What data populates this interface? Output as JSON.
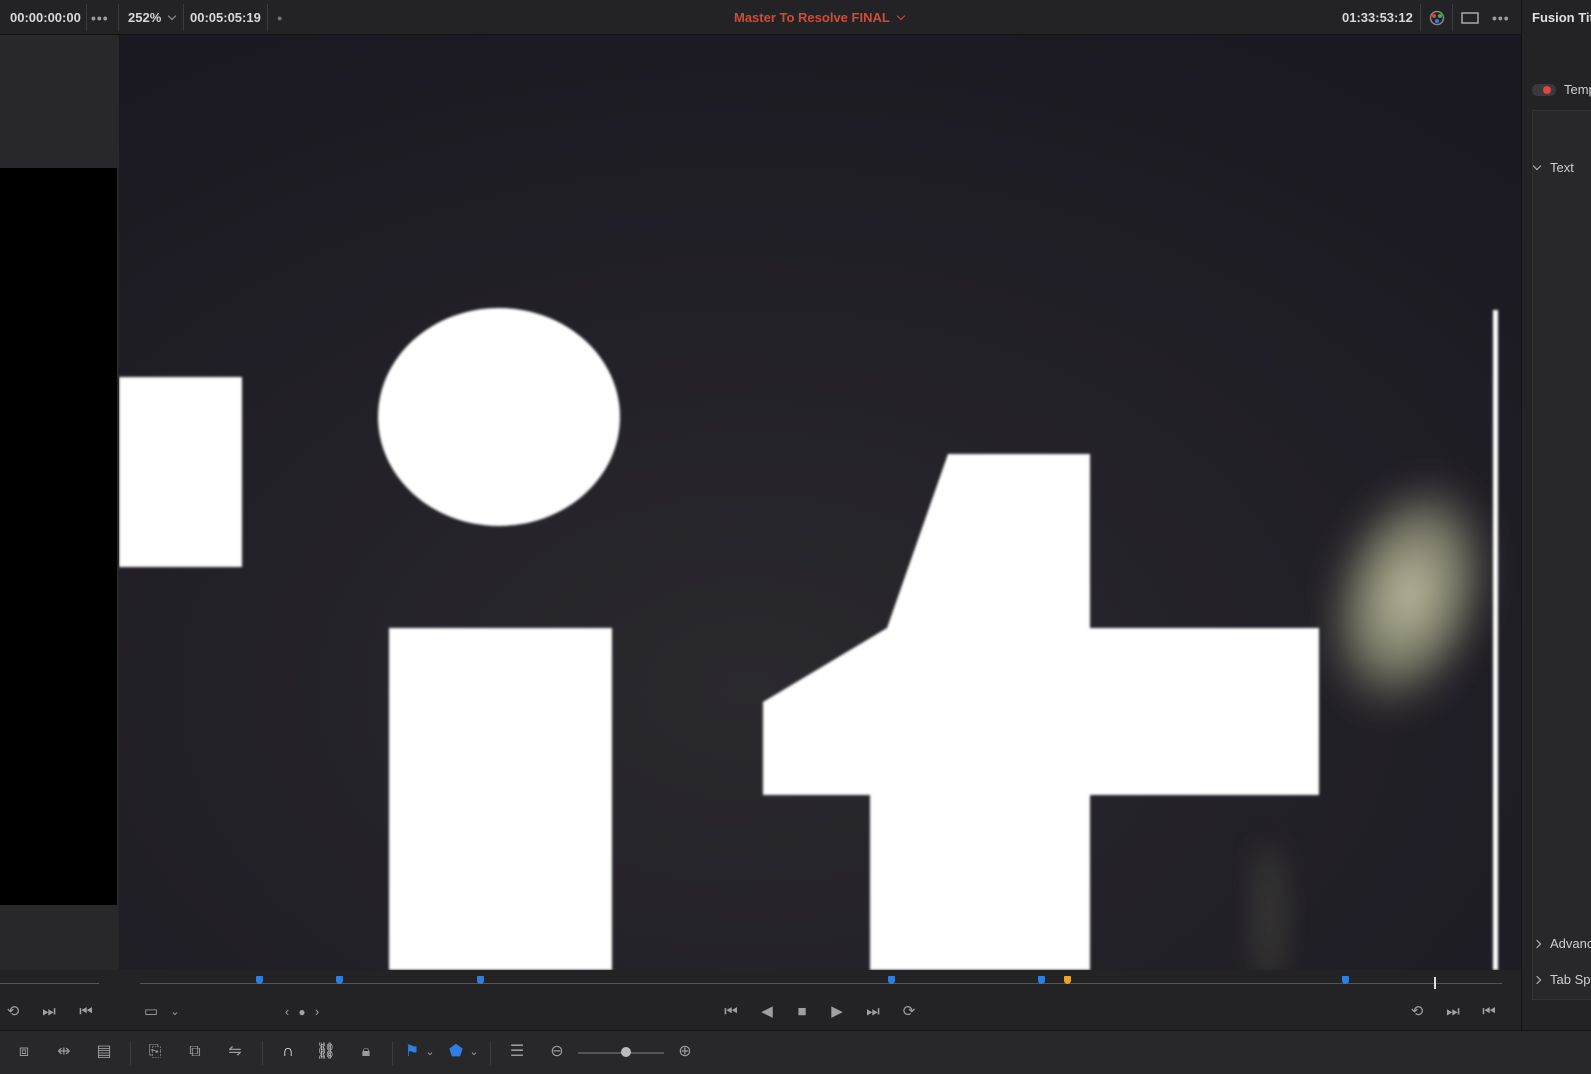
{
  "topbar": {
    "source_timecode": "00:00:00:00",
    "zoom": "252%",
    "duration": "00:05:05:19",
    "timeline_name": "Master To Resolve FINAL",
    "record_timecode": "01:33:53:12",
    "more_glyph": "•••",
    "title_color": "#d24a38"
  },
  "inspector": {
    "title": "Fusion Titles",
    "template_label": "Template",
    "sections": [
      "Text",
      "Advanced Controls",
      "Tab Spacing"
    ]
  },
  "viewer": {
    "text_shown": "i4"
  },
  "transport": {
    "markers": [
      {
        "color": "#2f7fe0"
      },
      {
        "color": "#2f7fe0"
      },
      {
        "color": "#2f7fe0"
      },
      {
        "color": "#2f7fe0"
      },
      {
        "color": "#2f7fe0"
      },
      {
        "color": "#e9a42a"
      },
      {
        "color": "#2f7fe0"
      }
    ]
  },
  "icons": {
    "loop": "loop-icon",
    "jump_end": "jump-to-end-icon",
    "jump_start": "jump-to-start-icon",
    "play": "play-icon",
    "stop": "stop-icon",
    "reverse": "play-reverse-icon",
    "snap": "snapping-icon",
    "link": "linked-selection-icon",
    "lock": "position-lock-icon",
    "flag": "flag-icon",
    "marker": "marker-icon",
    "zoom_out": "zoom-out-icon",
    "zoom_in": "zoom-in-icon"
  }
}
